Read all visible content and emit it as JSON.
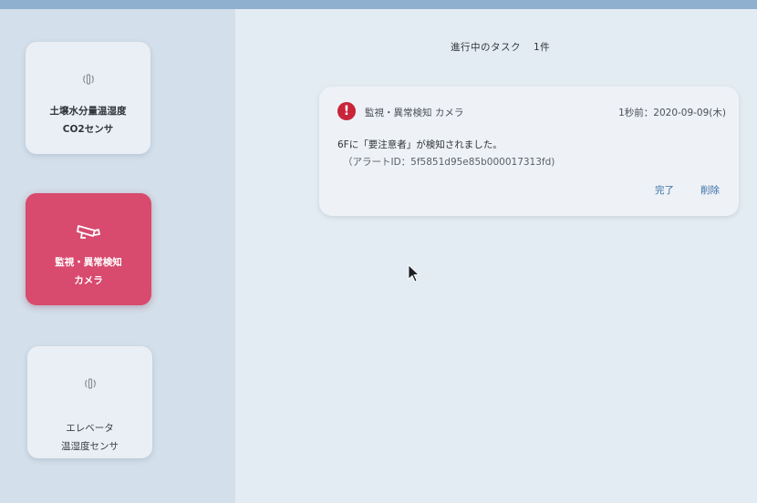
{
  "sidebar": {
    "cards": [
      {
        "label": "土壌水分量温湿度\nCO2センサ",
        "icon": "wireless-signal-icon",
        "active": false
      },
      {
        "label": "監視・異常検知\nカメラ",
        "icon": "security-camera-icon",
        "active": true
      },
      {
        "label": "エレベータ\n温湿度センサ",
        "icon": "wireless-signal-icon",
        "active": false
      }
    ]
  },
  "main": {
    "header": {
      "title": "進行中のタスク",
      "count": "1件"
    },
    "alert": {
      "icon": "exclamation-icon",
      "source": "監視・異常検知 カメラ",
      "time": "1秒前：2020-09-09(木)",
      "message": "6Fに「要注意者」が検知されました。",
      "alert_id": "（アラートID：5f5851d95e85b000017313fd)",
      "complete_label": "完了",
      "delete_label": "削除"
    }
  },
  "colors": {
    "accent": "#d84a6e",
    "alert": "#c8253b",
    "link": "#3a6fa8"
  }
}
